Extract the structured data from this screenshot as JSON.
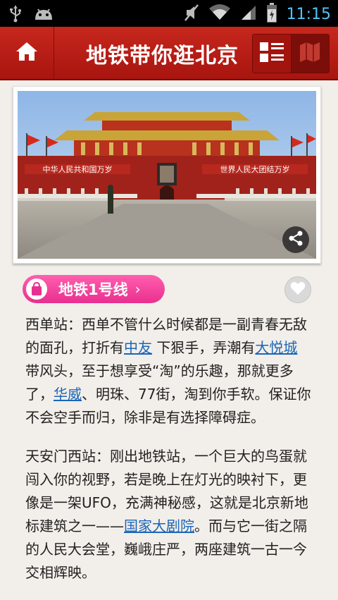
{
  "status_bar": {
    "time": "11:15",
    "icons": [
      "usb-icon",
      "android-debug-icon",
      "mute-icon",
      "wifi-icon",
      "signal-icon",
      "battery-icon"
    ]
  },
  "header": {
    "title": "地铁带你逛北京",
    "home_icon": "home-icon",
    "list_icon": "list-view-icon",
    "map_icon": "map-view-icon"
  },
  "hero": {
    "left_banner": "中华人民共和国万岁",
    "right_banner": "世界人民大团结万岁"
  },
  "line": {
    "label": "地铁1号线",
    "icon": "shopping-bag-icon",
    "arrow": "›"
  },
  "favorite_icon": "heart-icon",
  "share_icon": "share-icon",
  "paragraphs": [
    [
      {
        "t": "西单站：西单不管什么时候都是一副青春无敌的面孔，打折有"
      },
      {
        "t": "中友",
        "link": true
      },
      {
        "t": " 下狠手，弄潮有"
      },
      {
        "t": "大悦城",
        "link": true
      },
      {
        "t": " 带风头，至于想享受“淘”的乐趣，那就更多了，"
      },
      {
        "t": "华威",
        "link": true
      },
      {
        "t": "、明珠、77街，淘到你手软。保证你不会空手而归，除非是有选择障碍症。"
      }
    ],
    [
      {
        "t": "天安门西站：刚出地铁站，一个巨大的鸟蛋就闯入你的视野，若是晚上在灯光的映衬下，更像是一架UFO，充满神秘感，这就是北京新地标建筑之一——"
      },
      {
        "t": "国家大剧院",
        "link": true
      },
      {
        "t": "。而与它一街之隔的人民大会堂，巍峨庄严，两座建筑一古一今交相辉映。"
      }
    ]
  ],
  "colors": {
    "header_red": "#b51c14",
    "pill_pink": "#f0439a",
    "link_blue": "#1a66b8",
    "background": "#f2eee9",
    "time_blue": "#4fc3f7"
  }
}
